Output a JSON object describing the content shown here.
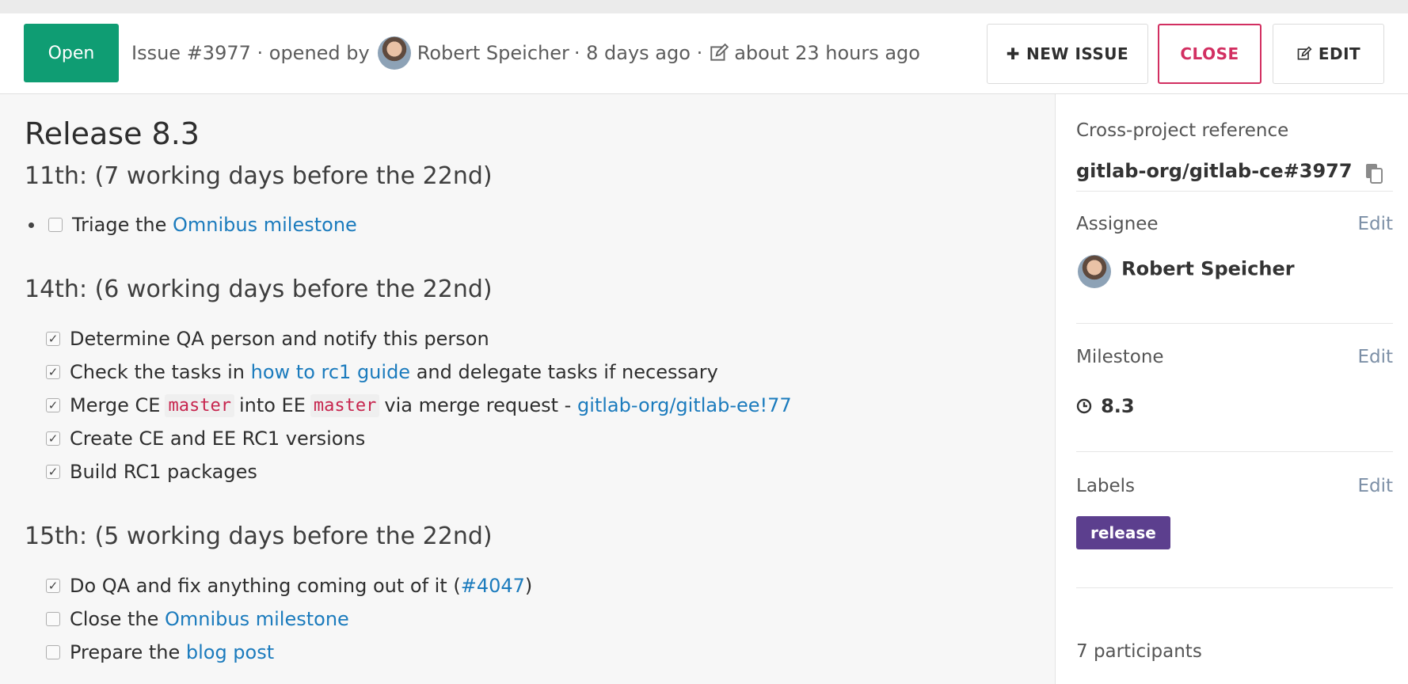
{
  "header": {
    "status": "Open",
    "issue_ref": "Issue #3977 · opened by",
    "author": "Robert Speicher",
    "opened": "· 8 days ago ·",
    "edited": "about 23 hours ago",
    "buttons": {
      "new_issue": "NEW ISSUE",
      "close": "CLOSE",
      "edit": "EDIT"
    }
  },
  "issue": {
    "title": "Release 8.3",
    "sections": [
      {
        "heading": "11th: (7 working days before the 22nd)",
        "tasks": [
          {
            "text": "Triage the ",
            "link": "Omnibus milestone",
            "checked": false
          }
        ]
      },
      {
        "heading": "14th: (6 working days before the 22nd)",
        "tasks": [
          {
            "text": "Determine QA person and notify this person",
            "checked": true
          },
          {
            "text": "Check the tasks in ",
            "link": "how to rc1 guide",
            "after": " and delegate tasks if necessary",
            "checked": true
          },
          {
            "text": "Merge CE",
            "code1": "master",
            "mid": "into EE",
            "code2": "master",
            "after": "via merge request - ",
            "link": "gitlab-org/gitlab-ee!77",
            "checked": true
          },
          {
            "text": "Create CE and EE RC1 versions",
            "checked": true
          },
          {
            "text": "Build RC1 packages",
            "checked": true
          }
        ]
      },
      {
        "heading": "15th: (5 working days before the 22nd)",
        "tasks": [
          {
            "text": "Do QA and fix anything coming out of it (",
            "link": "#4047",
            "after": ")",
            "checked": true
          },
          {
            "text": "Close the ",
            "link": "Omnibus milestone",
            "checked": false
          },
          {
            "text": "Prepare the ",
            "link": "blog post",
            "checked": false
          }
        ]
      }
    ]
  },
  "sidebar": {
    "reference": {
      "label": "Cross-project reference",
      "value": "gitlab-org/gitlab-ce#3977"
    },
    "assignee": {
      "label": "Assignee",
      "edit": "Edit",
      "name": "Robert Speicher"
    },
    "milestone": {
      "label": "Milestone",
      "edit": "Edit",
      "value": "8.3"
    },
    "labels": {
      "label": "Labels",
      "edit": "Edit",
      "badge": "release",
      "badge_color": "#5c3f8e"
    },
    "participants": "7 participants"
  },
  "colors": {
    "open_status": "#0f9d73",
    "close_button": "#d22f61",
    "link": "#1b7bbd",
    "code": "#c7254e"
  }
}
